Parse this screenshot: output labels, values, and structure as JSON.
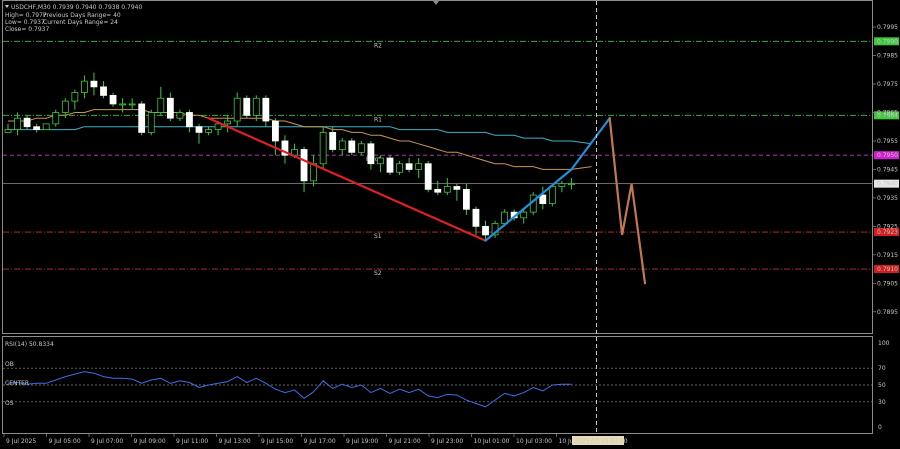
{
  "header": {
    "symbol_line": "USDCHF,M30  0.7939 0.7940 0.7938 0.7940",
    "high_line": "High= 0.7977",
    "low_line": "Low= 0.7937",
    "close_line": "Close= 0.7937",
    "prev_range": "Previous Days Range= 40",
    "cur_range": "Current Days Range= 24"
  },
  "rsi_label": "RSI(14) 50.8334",
  "rsi_levels": {
    "ob": "OB",
    "center": "CENTER",
    "os": "OS"
  },
  "price_axis": [
    "0.7995",
    "0.7985",
    "0.7975",
    "0.7965",
    "0.7955",
    "0.7945",
    "0.7935",
    "0.7925",
    "0.7915",
    "0.7905",
    "0.7895"
  ],
  "rsi_axis": [
    "100",
    "70",
    "50",
    "30",
    "0"
  ],
  "time_axis": [
    "9 Jul 2025",
    "9 Jul 05:00",
    "9 Jul 07:00",
    "9 Jul 09:00",
    "9 Jul 11:00",
    "9 Jul 13:00",
    "9 Jul 15:00",
    "9 Jul 17:00",
    "9 Jul 19:00",
    "9 Jul 21:00",
    "9 Jul 23:00",
    "10 Jul 01:00",
    "10 Jul 03:00",
    "10 Jul"
  ],
  "time_highlight": "2025.07.10 07:00",
  "levels": [
    {
      "name": "R2",
      "price": 0.799,
      "color": "#3cc83c",
      "style": "dashdot",
      "tag": "0.7990",
      "tagColor": "#3cc83c"
    },
    {
      "name": "R1",
      "price": 0.7964,
      "color": "#3cc83c",
      "style": "dashdot",
      "tag": "0.7964",
      "tagColor": "#3cc83c"
    },
    {
      "name": "Pivot",
      "price": 0.795,
      "color": "#c83cc8",
      "style": "dash",
      "tag": "0.7950",
      "tagColor": "#d020d0"
    },
    {
      "name": "S1",
      "price": 0.7923,
      "color": "#c83232",
      "style": "dashdot",
      "tag": "0.7923",
      "tagColor": "#d01e1e"
    },
    {
      "name": "S2",
      "price": 0.791,
      "color": "#c83232",
      "style": "dashdot",
      "tag": "0.7910",
      "tagColor": "#d01e1e"
    }
  ],
  "current_price": {
    "value": 0.794,
    "tag": "0.7940"
  },
  "chart_data": {
    "type": "candlestick",
    "timeframe": "M30",
    "ylim": [
      0.789,
      0.8001
    ],
    "candles": [
      [
        0.7958,
        0.7961,
        0.7958,
        0.7959
      ],
      [
        0.7959,
        0.7965,
        0.7957,
        0.7963
      ],
      [
        0.7963,
        0.7964,
        0.7959,
        0.796
      ],
      [
        0.796,
        0.7961,
        0.7958,
        0.7959
      ],
      [
        0.7959,
        0.7961,
        0.7959,
        0.7961
      ],
      [
        0.7961,
        0.7966,
        0.796,
        0.7965
      ],
      [
        0.7965,
        0.797,
        0.7963,
        0.7969
      ],
      [
        0.7969,
        0.7973,
        0.7966,
        0.7972
      ],
      [
        0.7972,
        0.7978,
        0.797,
        0.7976
      ],
      [
        0.7976,
        0.7979,
        0.7971,
        0.7974
      ],
      [
        0.7974,
        0.7976,
        0.797,
        0.7971
      ],
      [
        0.7971,
        0.7972,
        0.7967,
        0.7968
      ],
      [
        0.7968,
        0.797,
        0.7965,
        0.7968
      ],
      [
        0.7968,
        0.797,
        0.7966,
        0.7968
      ],
      [
        0.7968,
        0.7969,
        0.7957,
        0.7958
      ],
      [
        0.7958,
        0.7966,
        0.7957,
        0.7965
      ],
      [
        0.7965,
        0.7974,
        0.7964,
        0.797
      ],
      [
        0.797,
        0.7972,
        0.7962,
        0.7963
      ],
      [
        0.7963,
        0.7966,
        0.7962,
        0.7965
      ],
      [
        0.7965,
        0.7966,
        0.7958,
        0.796
      ],
      [
        0.796,
        0.7961,
        0.7954,
        0.7958
      ],
      [
        0.7958,
        0.796,
        0.7957,
        0.7959
      ],
      [
        0.7959,
        0.7962,
        0.7957,
        0.7961
      ],
      [
        0.7961,
        0.7964,
        0.7958,
        0.7962
      ],
      [
        0.7962,
        0.7972,
        0.796,
        0.797
      ],
      [
        0.797,
        0.7971,
        0.7963,
        0.7964
      ],
      [
        0.7964,
        0.7971,
        0.7962,
        0.797
      ],
      [
        0.797,
        0.7971,
        0.796,
        0.7962
      ],
      [
        0.7962,
        0.7963,
        0.795,
        0.7955
      ],
      [
        0.7955,
        0.7957,
        0.7947,
        0.795
      ],
      [
        0.795,
        0.7954,
        0.7949,
        0.7952
      ],
      [
        0.7952,
        0.7953,
        0.7937,
        0.7941
      ],
      [
        0.7941,
        0.795,
        0.7939,
        0.7947
      ],
      [
        0.7947,
        0.796,
        0.7945,
        0.7958
      ],
      [
        0.7958,
        0.796,
        0.7951,
        0.7952
      ],
      [
        0.7952,
        0.7956,
        0.795,
        0.7955
      ],
      [
        0.7955,
        0.7956,
        0.795,
        0.7951
      ],
      [
        0.7951,
        0.7955,
        0.795,
        0.7954
      ],
      [
        0.7954,
        0.7955,
        0.7945,
        0.7947
      ],
      [
        0.7947,
        0.795,
        0.7944,
        0.7949
      ],
      [
        0.7949,
        0.795,
        0.7943,
        0.7944
      ],
      [
        0.7944,
        0.7948,
        0.7943,
        0.7947
      ],
      [
        0.7947,
        0.7949,
        0.7944,
        0.7945
      ],
      [
        0.7945,
        0.7949,
        0.7942,
        0.7947
      ],
      [
        0.7947,
        0.7948,
        0.7937,
        0.7938
      ],
      [
        0.7938,
        0.7941,
        0.7936,
        0.7937
      ],
      [
        0.7937,
        0.7942,
        0.7936,
        0.7939
      ],
      [
        0.7939,
        0.794,
        0.7934,
        0.7938
      ],
      [
        0.7938,
        0.794,
        0.7929,
        0.7931
      ],
      [
        0.7931,
        0.7932,
        0.7922,
        0.7925
      ],
      [
        0.7925,
        0.7927,
        0.792,
        0.7922
      ],
      [
        0.7922,
        0.7927,
        0.7921,
        0.7926
      ],
      [
        0.7926,
        0.7931,
        0.7925,
        0.793
      ],
      [
        0.793,
        0.7931,
        0.7927,
        0.7928
      ],
      [
        0.7928,
        0.7931,
        0.7926,
        0.793
      ],
      [
        0.793,
        0.7937,
        0.7929,
        0.7936
      ],
      [
        0.7936,
        0.7939,
        0.7931,
        0.7933
      ],
      [
        0.7933,
        0.794,
        0.7932,
        0.7939
      ],
      [
        0.7939,
        0.7941,
        0.7937,
        0.794
      ],
      [
        0.794,
        0.7942,
        0.7938,
        0.794
      ]
    ],
    "ma_fast": [
      0.7962,
      0.7962,
      0.7962,
      0.7963,
      0.7963,
      0.7964,
      0.7964,
      0.7965,
      0.7965,
      0.7966,
      0.7966,
      0.7966,
      0.7966,
      0.7966,
      0.7966,
      0.7965,
      0.7965,
      0.7965,
      0.7965,
      0.7964,
      0.7964,
      0.7963,
      0.7963,
      0.7963,
      0.7963,
      0.7963,
      0.7963,
      0.7963,
      0.7962,
      0.7962,
      0.7961,
      0.796,
      0.796,
      0.796,
      0.7959,
      0.7959,
      0.7958,
      0.7958,
      0.7957,
      0.7957,
      0.7956,
      0.7955,
      0.7955,
      0.7954,
      0.7953,
      0.7952,
      0.7951,
      0.7951,
      0.795,
      0.7949,
      0.7948,
      0.7947,
      0.7947,
      0.7946,
      0.7946,
      0.7946,
      0.7945,
      0.7945,
      0.7945,
      0.7945
    ],
    "ma_slow": [
      0.7959,
      0.7959,
      0.7959,
      0.7959,
      0.7959,
      0.7959,
      0.7959,
      0.7959,
      0.796,
      0.796,
      0.796,
      0.796,
      0.796,
      0.796,
      0.796,
      0.796,
      0.796,
      0.796,
      0.796,
      0.796,
      0.796,
      0.796,
      0.796,
      0.796,
      0.796,
      0.796,
      0.796,
      0.796,
      0.796,
      0.796,
      0.796,
      0.796,
      0.796,
      0.796,
      0.796,
      0.796,
      0.796,
      0.796,
      0.796,
      0.796,
      0.796,
      0.7959,
      0.7959,
      0.7959,
      0.7959,
      0.7959,
      0.7958,
      0.7958,
      0.7958,
      0.7958,
      0.7958,
      0.7957,
      0.7957,
      0.7957,
      0.7956,
      0.7956,
      0.7956,
      0.7955,
      0.7955,
      0.7955
    ],
    "rsi": {
      "name": "RSI(14)",
      "ylim": [
        0,
        100
      ],
      "levels": [
        70,
        50,
        30
      ],
      "values": [
        52,
        53,
        51,
        52,
        52,
        56,
        60,
        63,
        66,
        64,
        60,
        58,
        58,
        57,
        52,
        56,
        58,
        52,
        55,
        53,
        47,
        50,
        52,
        54,
        60,
        53,
        58,
        52,
        45,
        41,
        44,
        34,
        42,
        55,
        46,
        51,
        47,
        50,
        41,
        46,
        40,
        45,
        41,
        45,
        37,
        35,
        39,
        38,
        32,
        28,
        24,
        32,
        40,
        37,
        41,
        47,
        43,
        50,
        51,
        51
      ]
    },
    "trend_lines": [
      {
        "name": "down",
        "color": "#e02020",
        "from": [
          21,
          0.7963
        ],
        "to": [
          50,
          0.792
        ]
      },
      {
        "name": "up",
        "color": "#2090d8",
        "from": [
          50,
          0.792
        ],
        "to": [
          59,
          0.7945
        ]
      },
      {
        "name": "projection-up",
        "color": "#2090d8",
        "from": [
          59,
          0.7945
        ],
        "to": [
          63,
          0.7963
        ]
      },
      {
        "name": "projection-down",
        "color": "#c07850",
        "points": [
          [
            63,
            0.7963
          ],
          [
            64.3,
            0.7922
          ],
          [
            65.3,
            0.794
          ],
          [
            66.7,
            0.7905
          ]
        ]
      }
    ]
  }
}
